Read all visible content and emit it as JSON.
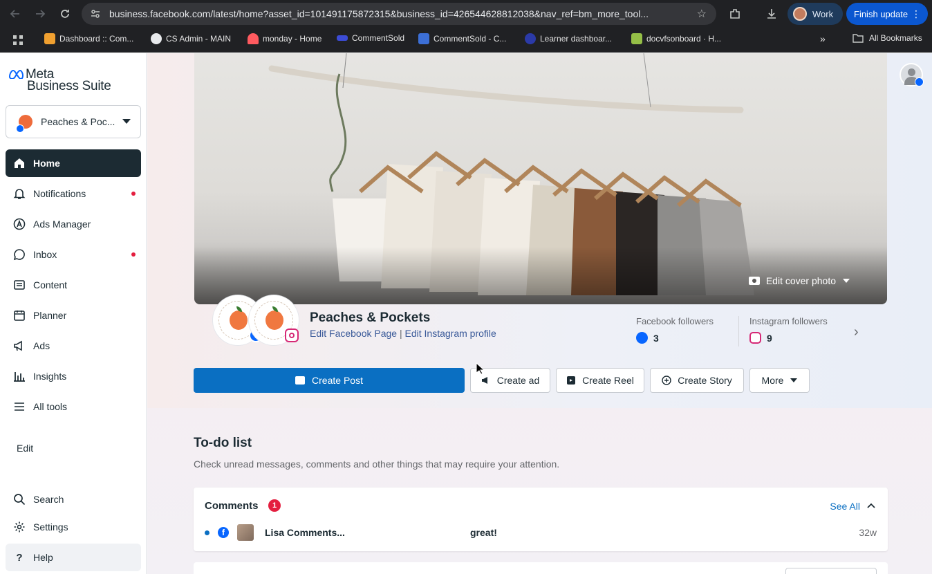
{
  "browser": {
    "url": "business.facebook.com/latest/home?asset_id=101491175872315&business_id=426544628812038&nav_ref=bm_more_tool...",
    "profile_label": "Work",
    "update_label": "Finish update",
    "bookmarks": [
      {
        "label": "Dashboard :: Com...",
        "color": "#f0a030"
      },
      {
        "label": "CS Admin - MAIN",
        "color": "#e8eaed"
      },
      {
        "label": "monday - Home",
        "color": "#ff5a5f"
      },
      {
        "label": "CommentSold",
        "color": "#3c4cd6"
      },
      {
        "label": "CommentSold - C...",
        "color": "#3c6fd6"
      },
      {
        "label": "Learner dashboar...",
        "color": "#2b3aa8"
      },
      {
        "label": "docvfsonboard · H...",
        "color": "#95bf47"
      }
    ],
    "all_bookmarks": "All Bookmarks"
  },
  "sidebar": {
    "logo_line1": "Meta",
    "logo_line2": "Business Suite",
    "account_name": "Peaches & Poc...",
    "items": [
      {
        "label": "Home",
        "active": true
      },
      {
        "label": "Notifications",
        "dot": true
      },
      {
        "label": "Ads Manager"
      },
      {
        "label": "Inbox",
        "dot": true
      },
      {
        "label": "Content"
      },
      {
        "label": "Planner"
      },
      {
        "label": "Ads"
      },
      {
        "label": "Insights"
      },
      {
        "label": "All tools"
      }
    ],
    "edit_label": "Edit",
    "search_label": "Search",
    "settings_label": "Settings",
    "help_label": "Help"
  },
  "profile": {
    "edit_cover": "Edit cover photo",
    "page_name": "Peaches & Pockets",
    "edit_fb": "Edit Facebook Page",
    "separator": "|",
    "edit_ig": "Edit Instagram profile",
    "fb_followers_label": "Facebook followers",
    "fb_followers": "3",
    "ig_followers_label": "Instagram followers",
    "ig_followers": "9"
  },
  "actions": {
    "create_post": "Create Post",
    "create_ad": "Create ad",
    "create_reel": "Create Reel",
    "create_story": "Create Story",
    "more": "More"
  },
  "todo": {
    "title": "To-do list",
    "subtitle": "Check unread messages, comments and other things that may require your attention.",
    "comments": {
      "title": "Comments",
      "count": "1",
      "see_all": "See All",
      "rows": [
        {
          "author": "Lisa Comments...",
          "message": "great!",
          "time": "32w"
        }
      ]
    }
  },
  "colors": {
    "primary": "#0a6fc2",
    "sidebar_active": "#1c2b33",
    "alert": "#e41e3f"
  }
}
